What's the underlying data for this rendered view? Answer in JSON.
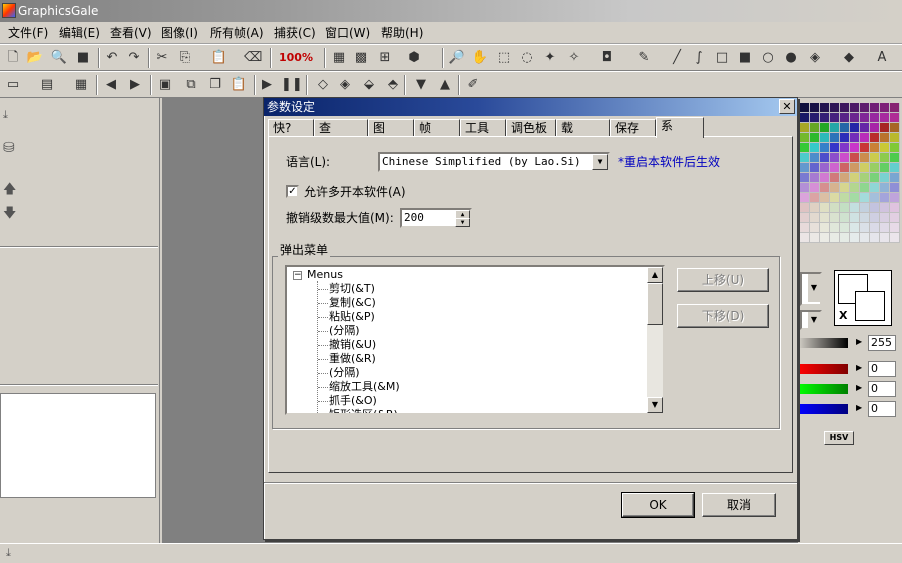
{
  "app": {
    "title": "GraphicsGale"
  },
  "menubar": [
    "文件(F)",
    "编辑(E)",
    "查看(V)",
    "图像(I)",
    "所有帧(A)",
    "捕获(C)",
    "窗口(W)",
    "帮助(H)"
  ],
  "toolbar": {
    "zoom": "100%"
  },
  "dialog": {
    "title": "参数设定",
    "close": "✕",
    "tabs": [
      "快?",
      "查",
      "图",
      "帧",
      "工具",
      "调色板",
      "载",
      "保存",
      "系"
    ],
    "active_tab": "系",
    "language": {
      "label": "语言(L):",
      "value": "Chinese Simplified (by Lao.Si)",
      "hint": "*重启本软件后生效"
    },
    "multi_instance": {
      "label": "允许多开本软件(A)",
      "checked": true
    },
    "undo": {
      "label": "撤销级数最大值(M):",
      "value": "200"
    },
    "popup_menu": {
      "label": "弹出菜单",
      "root": "Menus",
      "items": [
        "剪切(&T)",
        "复制(&C)",
        "粘贴(&P)",
        "(分隔)",
        "撤销(&U)",
        "重做(&R)",
        "(分隔)",
        "缩放工具(&M)",
        "抓手(&O)",
        "矩形选区(&R)"
      ]
    },
    "move_up": "上移(U)",
    "move_down": "下移(D)",
    "ok": "OK",
    "cancel": "取消"
  },
  "color_panel": {
    "values": [
      "255",
      "0",
      "0",
      "0"
    ],
    "x_marker": "X",
    "hsv_tab": "HSV"
  }
}
